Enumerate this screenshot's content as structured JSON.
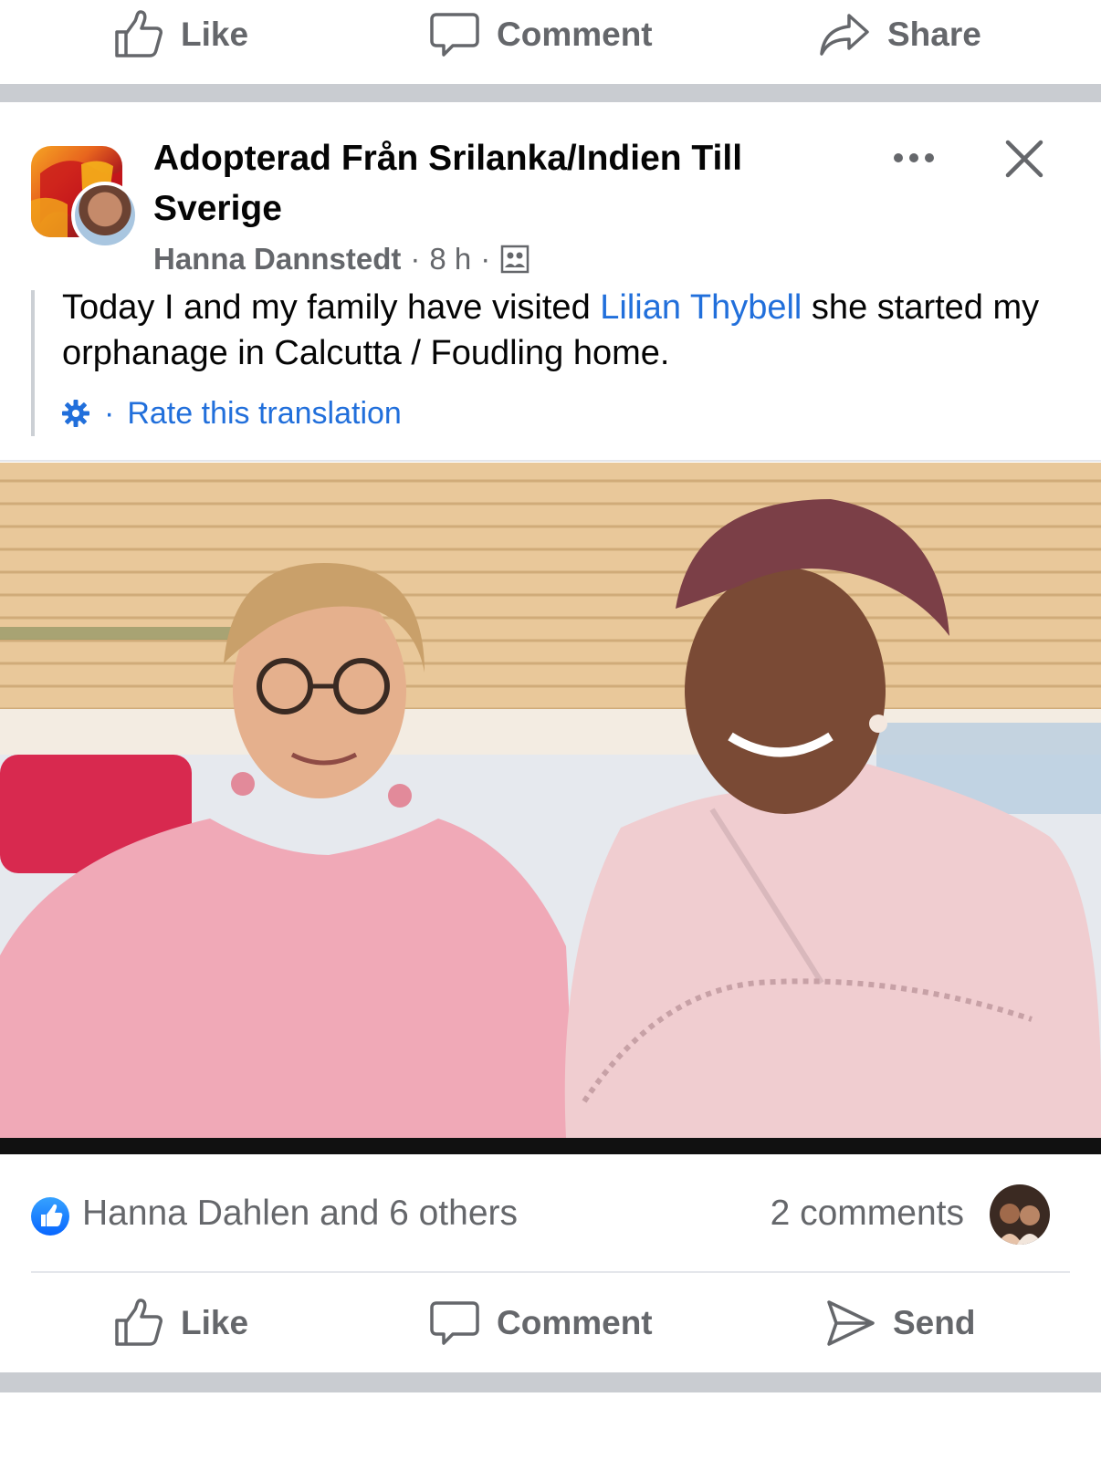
{
  "top_actions": {
    "like": "Like",
    "comment": "Comment",
    "share": "Share"
  },
  "post": {
    "group_name": "Adopterad Från Srilanka/Indien Till Sverige",
    "author": "Hanna Dannstedt",
    "time": "8 h",
    "audience_icon": "group-members-icon",
    "text_before": "Today I and my family have visited ",
    "mention": "Lilian Thybell",
    "text_after": " she started my orphanage in Calcutta / Foudling home.",
    "translation_link": "Rate this translation"
  },
  "reactions": {
    "summary": "Hanna Dahlen and 6 others",
    "comments": "2 comments"
  },
  "bottom_actions": {
    "like": "Like",
    "comment": "Comment",
    "send": "Send"
  },
  "colors": {
    "link_blue": "#216fdb",
    "secondary_text": "#65676b",
    "separator": "#c9ccd1",
    "like_blue": "#0866ff"
  }
}
